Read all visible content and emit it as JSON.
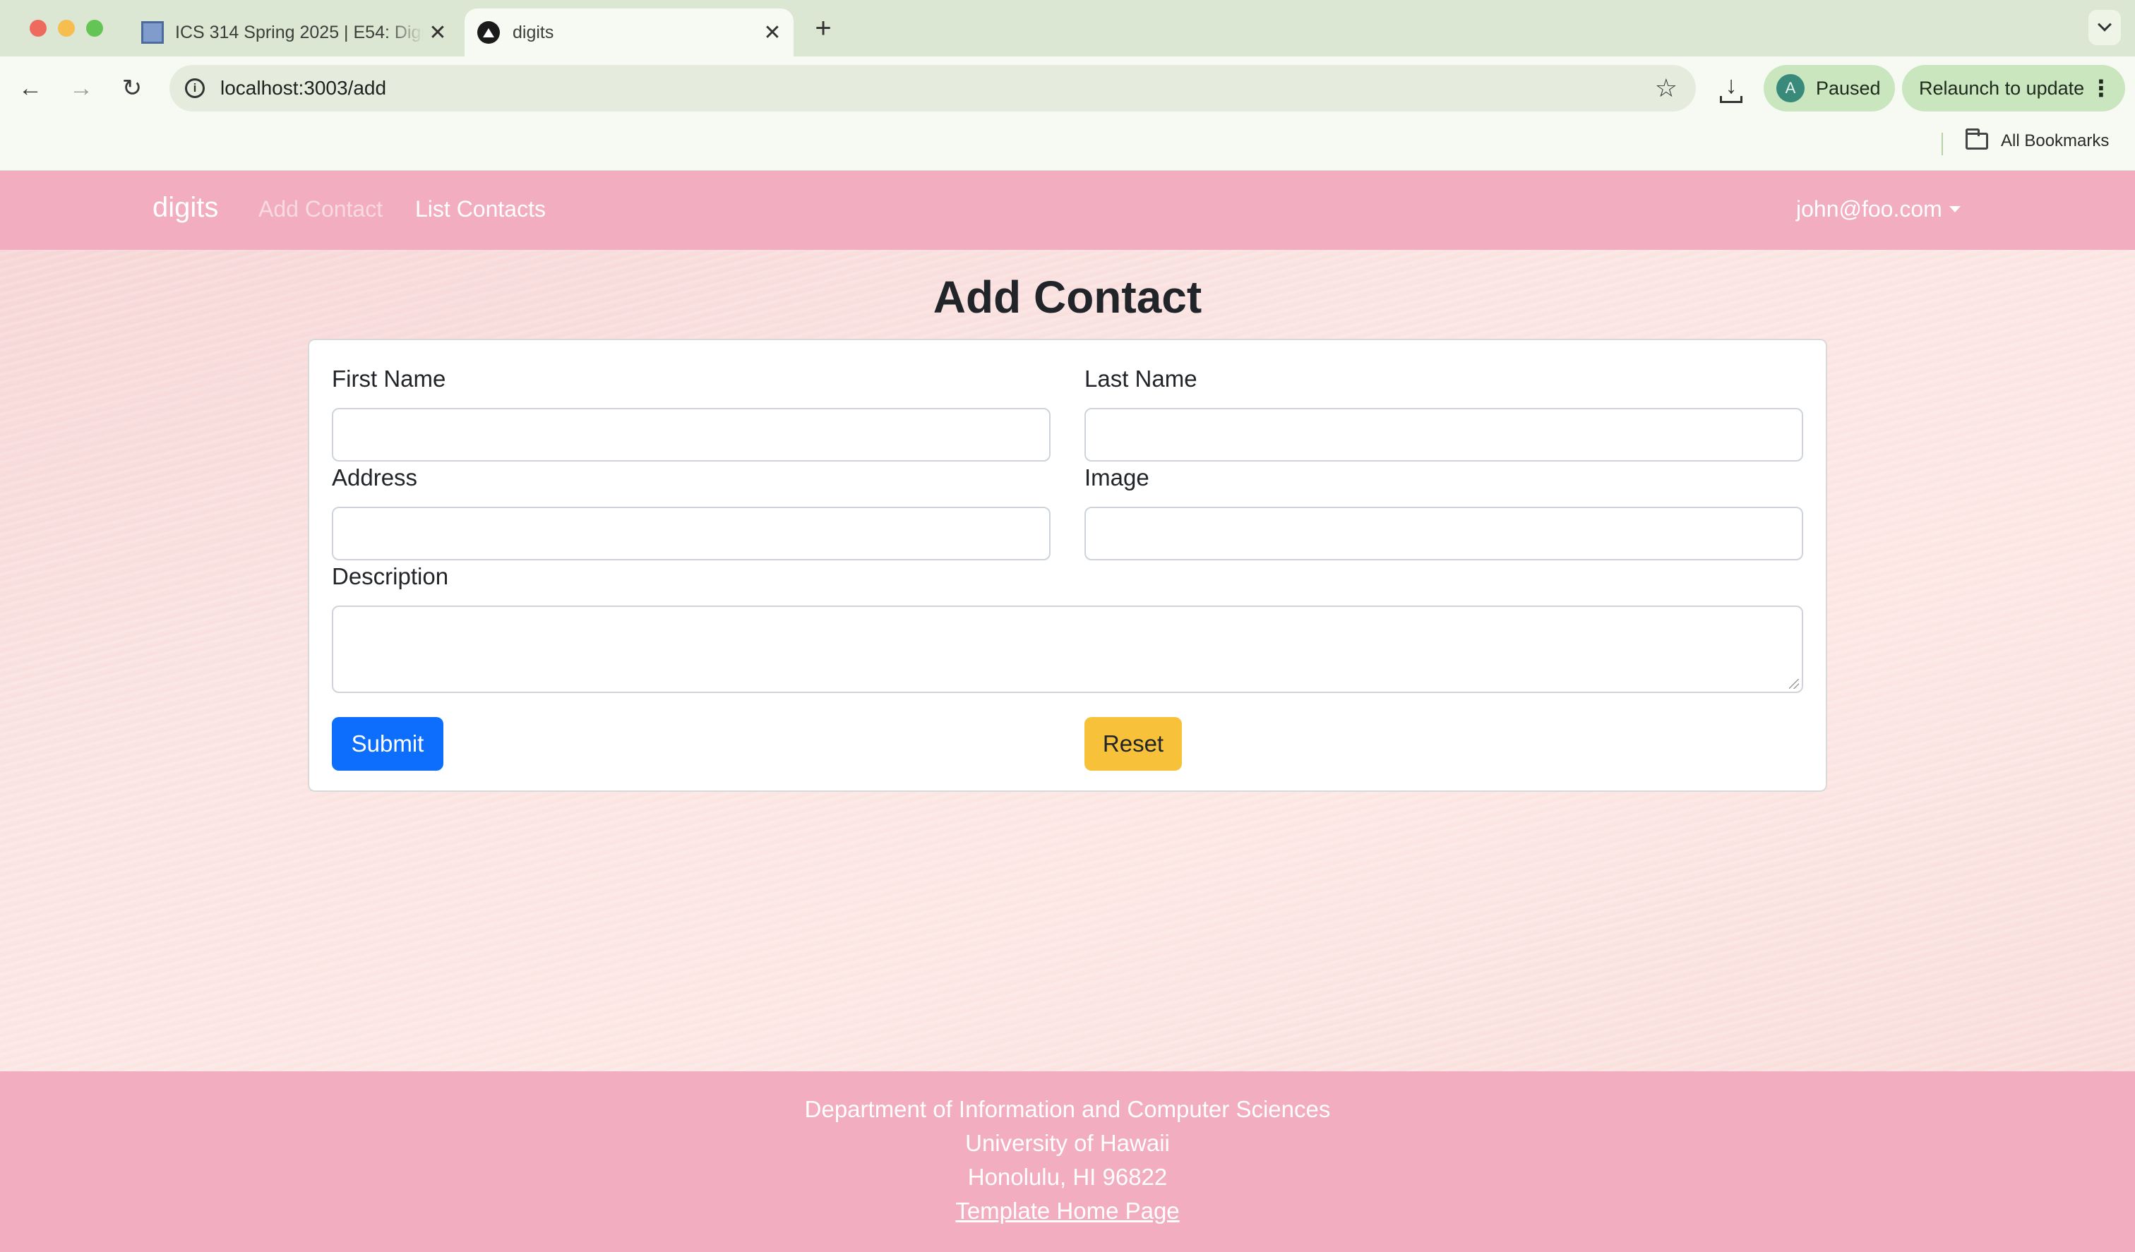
{
  "browser": {
    "tabs": [
      {
        "title": "ICS 314 Spring 2025 | E54: Digits",
        "active": false
      },
      {
        "title": "digits",
        "active": true
      }
    ],
    "new_tab": "+",
    "url": "localhost:3003/add",
    "profile": {
      "initial": "A",
      "status": "Paused"
    },
    "relaunch_label": "Relaunch to update",
    "bookmarks_label": "All Bookmarks"
  },
  "navbar": {
    "brand": "digits",
    "links": [
      {
        "label": "Add Contact",
        "active": true
      },
      {
        "label": "List Contacts",
        "active": false
      }
    ],
    "user": "john@foo.com"
  },
  "form": {
    "title": "Add Contact",
    "fields": {
      "first_name": {
        "label": "First Name",
        "value": ""
      },
      "last_name": {
        "label": "Last Name",
        "value": ""
      },
      "address": {
        "label": "Address",
        "value": ""
      },
      "image": {
        "label": "Image",
        "value": ""
      },
      "description": {
        "label": "Description",
        "value": ""
      }
    },
    "submit_label": "Submit",
    "reset_label": "Reset"
  },
  "footer": {
    "lines": [
      "Department of Information and Computer Sciences",
      "University of Hawaii",
      "Honolulu, HI 96822"
    ],
    "link": "Template Home Page"
  },
  "colors": {
    "navbar": "#f2adc1",
    "submit": "#0d6efd",
    "reset": "#f7c239"
  }
}
